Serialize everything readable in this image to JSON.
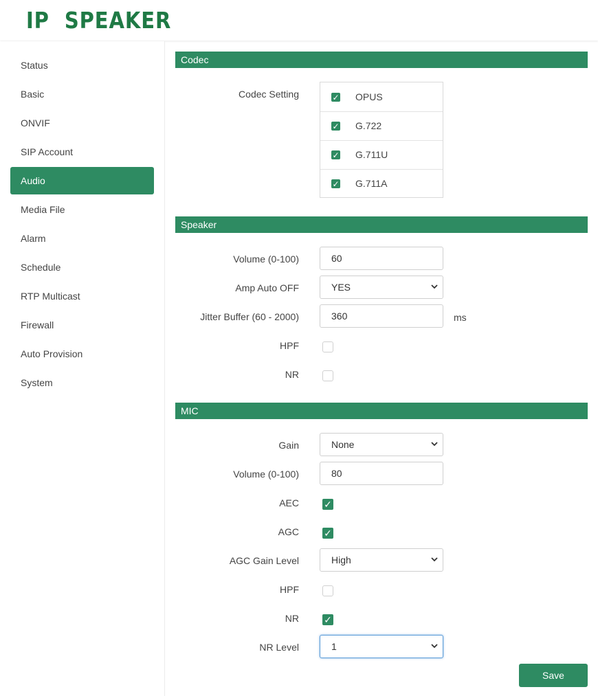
{
  "app": {
    "logo_text": "IP  SPEAKER"
  },
  "sidebar": {
    "items": [
      {
        "label": "Status"
      },
      {
        "label": "Basic"
      },
      {
        "label": "ONVIF"
      },
      {
        "label": "SIP Account"
      },
      {
        "label": "Audio",
        "active": true
      },
      {
        "label": "Media File"
      },
      {
        "label": "Alarm"
      },
      {
        "label": "Schedule"
      },
      {
        "label": "RTP Multicast"
      },
      {
        "label": "Firewall"
      },
      {
        "label": "Auto Provision"
      },
      {
        "label": "System"
      }
    ]
  },
  "codec": {
    "title": "Codec",
    "setting_label": "Codec Setting",
    "options": [
      {
        "name": "OPUS",
        "checked": true
      },
      {
        "name": "G.722",
        "checked": true
      },
      {
        "name": "G.711U",
        "checked": true
      },
      {
        "name": "G.711A",
        "checked": true
      }
    ]
  },
  "speaker": {
    "title": "Speaker",
    "volume_label": "Volume (0-100)",
    "volume_value": "60",
    "amp_label": "Amp Auto OFF",
    "amp_value": "YES",
    "jitter_label": "Jitter Buffer (60 - 2000)",
    "jitter_value": "360",
    "jitter_unit": "ms",
    "hpf_label": "HPF",
    "hpf_checked": false,
    "nr_label": "NR",
    "nr_checked": false
  },
  "mic": {
    "title": "MIC",
    "gain_label": "Gain",
    "gain_value": "None",
    "volume_label": "Volume (0-100)",
    "volume_value": "80",
    "aec_label": "AEC",
    "aec_checked": true,
    "agc_label": "AGC",
    "agc_checked": true,
    "agc_gain_label": "AGC Gain Level",
    "agc_gain_value": "High",
    "hpf_label": "HPF",
    "hpf_checked": false,
    "nr_label": "NR",
    "nr_checked": true,
    "nr_level_label": "NR Level",
    "nr_level_value": "1"
  },
  "actions": {
    "save_label": "Save"
  },
  "icons": {
    "check": "checkmark-icon",
    "dropdown": "chevron-down-icon"
  },
  "colors": {
    "brand": "#1f7a45",
    "accent": "#2e8b62",
    "focus": "#5a9bd8"
  }
}
